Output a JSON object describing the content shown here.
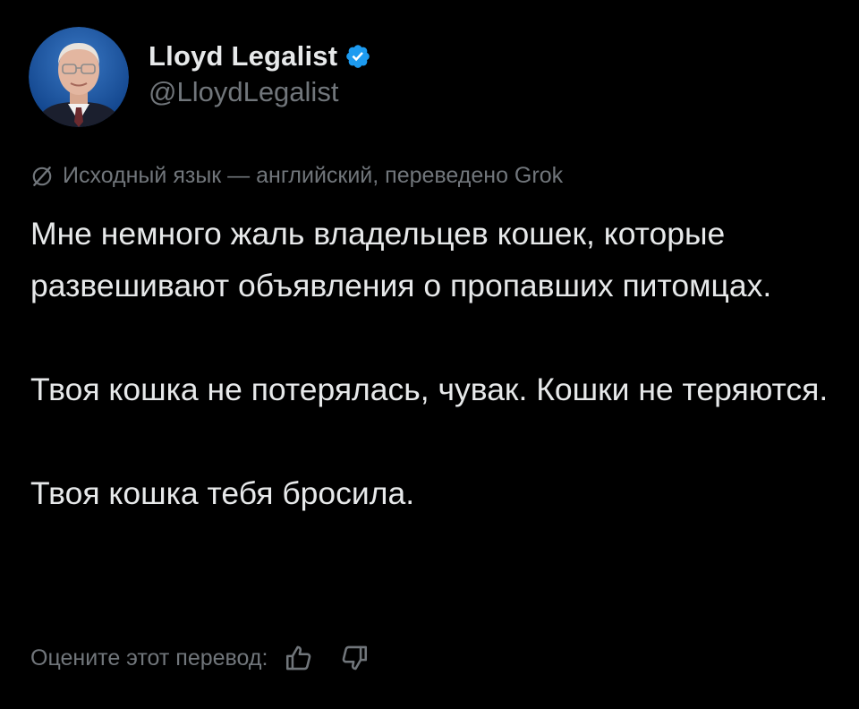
{
  "tweet": {
    "author": {
      "display_name": "Lloyd Legalist",
      "handle": "@LloydLegalist",
      "verified": true,
      "avatar_icon": "avatar-portrait"
    },
    "translation_note": "Исходный язык — английский, переведено Grok",
    "paragraphs": [
      "Мне немного жаль владельцев кошек, которые развешивают объявления о пропавших питомцах.",
      "Твоя кошка не потерялась, чувак. Кошки не теряются.",
      "Твоя кошка тебя бросила."
    ],
    "rate_prompt": "Оцените этот перевод:",
    "rate_icons": [
      "thumbs-up-icon",
      "thumbs-down-icon"
    ]
  },
  "colors": {
    "background": "#000000",
    "text_primary": "#e7e9ea",
    "text_secondary": "#71767b",
    "verified_badge": "#1d9bf0"
  }
}
